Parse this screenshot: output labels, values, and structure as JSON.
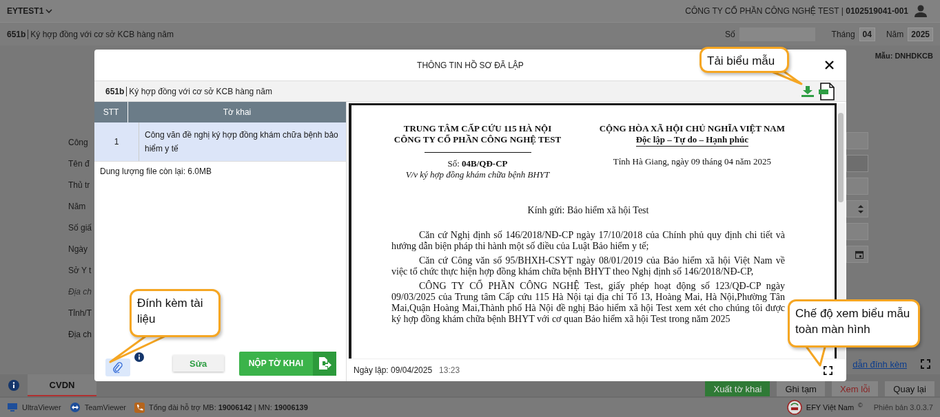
{
  "app_header": {
    "account": "EYTEST1",
    "company": "CÔNG TY CỔ PHẦN CÔNG NGHỆ TEST | **0102519041-001**"
  },
  "form_header": {
    "code": "651b",
    "title": "Ký hợp đồng với cơ sở KCB hàng năm",
    "number_label": "Số",
    "month_label": "Tháng",
    "month": "04",
    "year_label": "Năm",
    "year": "2025"
  },
  "template_label": "Mẫu: DNHDKCB",
  "form_labels": [
    {
      "text": "Công",
      "kind": "field"
    },
    {
      "text": "Tên đ",
      "kind": "field"
    },
    {
      "text": "Thủ tr",
      "kind": "field"
    },
    {
      "text": "Năm",
      "kind": "field"
    },
    {
      "text": "Số giấ",
      "kind": "field"
    },
    {
      "text": "Ngày",
      "kind": "field"
    },
    {
      "text": "Sở Y t",
      "kind": "field"
    },
    {
      "text": "Địa ch",
      "kind": "hint"
    },
    {
      "text": "Tỉnh/T",
      "kind": "field"
    },
    {
      "text": "Địa ch",
      "kind": "field"
    }
  ],
  "guide_link": "dẫn đính kèm",
  "tabs": [
    {
      "label": "CVDN",
      "selected": true
    }
  ],
  "actions": [
    {
      "label": "Xuất tờ khai",
      "kind": "primary"
    },
    {
      "label": "Ghi tạm",
      "kind": "default"
    },
    {
      "label": "Xem lỗi",
      "kind": "danger"
    },
    {
      "label": "Quay lại",
      "kind": "default"
    }
  ],
  "status_bar": {
    "tools": [
      "UltraViewer",
      "TeamViewer"
    ],
    "hotline": "Tổng đài hỗ trợ MB: **19006142** | MN: **19006139**",
    "brand": "EFY Việt Nam",
    "copyright": "©",
    "version": "Phiên bản 3.0.3.7"
  },
  "modal": {
    "title": "THÔNG TIN HỒ SƠ ĐÃ LẬP",
    "code": "651b",
    "form_title": "Ký hợp đồng với cơ sở KCB hàng năm",
    "columns": [
      "STT",
      "Tờ khai"
    ],
    "rows": [
      {
        "stt": "1",
        "name": "Công văn đề nghị ký hợp đồng khám chữa bệnh bảo hiểm y tế",
        "selected": true
      }
    ],
    "storage": "Dung lượng file còn lại: 6.0MB",
    "edit_button": "Sửa",
    "submit_button": "NỘP TỜ KHAI",
    "created": "Ngày lập: 09/04/2025",
    "created_time": "13:23",
    "document": {
      "org_lines": [
        "TRUNG TÂM CẤP CỨU 115 HÀ NỘI",
        "CÔNG TY CỔ PHẦN CÔNG NGHỆ TEST"
      ],
      "number": "Số: **04B/QĐ-CP**",
      "subject": "V/v ký hợp đồng khám chữa bệnh BHYT",
      "nation": "CỘNG HÒA XÃ HỘI CHỦ NGHĨA VIỆT NAM",
      "motto": "Độc lập – Tự do – Hạnh phúc",
      "place_date": "Tỉnh Hà Giang, ngày 09 tháng 04 năm 2025",
      "recipient": "Kính gửi: Bảo hiểm xã hội Test",
      "paragraphs": [
        "Căn cứ Nghị định số 146/2018/NĐ-CP ngày 17/10/2018 của Chính phủ quy định chi tiết và hướng dẫn biện pháp thi hành một số điều của Luật Bảo hiểm y tế;",
        "Căn cứ Công văn số 95/BHXH-CSYT ngày 08/01/2019 của Bảo hiểm xã hội Việt Nam về việc tổ chức thực hiện hợp đồng khám chữa bệnh BHYT theo Nghị định số 146/2018/NĐ-CP,",
        "CÔNG TY CỔ PHẦN CÔNG NGHỆ Test, giấy phép hoạt động số 123/QĐ-CP ngày 09/03/2025 của Trung tâm Cấp cứu 115 Hà Nội tại địa chỉ Tổ 13, Hoàng Mai, Hà Nội,Phường Tân Mai,Quận Hoàng Mai,Thành phố Hà Nội đề nghị Bảo hiểm xã hội Test xem xét cho chúng tôi được ký hợp đồng khám chữa bệnh BHYT với cơ quan Bảo hiểm xã hội Test trong năm 2025"
      ]
    }
  },
  "callouts": [
    {
      "text": "Tải biểu mẫu",
      "kind": "download"
    },
    {
      "text": "Đính kèm tài liệu",
      "kind": "attach"
    },
    {
      "text": "Chế độ xem biểu mẫu toàn màn hình",
      "kind": "fullscreen"
    }
  ]
}
